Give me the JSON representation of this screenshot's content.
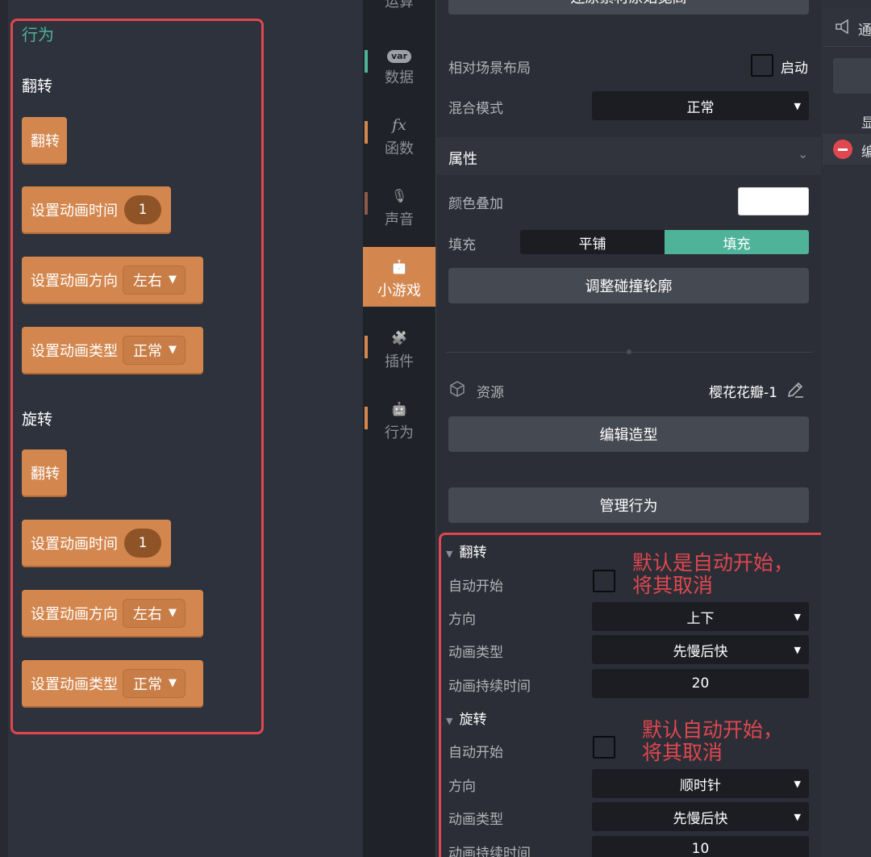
{
  "palette": {
    "category_title": "行为",
    "sections": [
      {
        "title": "翻转",
        "blocks": [
          {
            "label": "翻转"
          },
          {
            "label": "设置动画时间",
            "value": "1"
          },
          {
            "label": "设置动画方向",
            "option": "左右"
          },
          {
            "label": "设置动画类型",
            "option": "正常"
          }
        ]
      },
      {
        "title": "旋转",
        "blocks": [
          {
            "label": "翻转"
          },
          {
            "label": "设置动画时间",
            "value": "1"
          },
          {
            "label": "设置动画方向",
            "option": "左右"
          },
          {
            "label": "设置动画类型",
            "option": "正常"
          }
        ]
      }
    ]
  },
  "categories": [
    {
      "label": "运算",
      "icon": "operators-icon"
    },
    {
      "label": "数据",
      "icon": "var-icon",
      "icon_text": "var"
    },
    {
      "label": "函数",
      "icon": "fx-icon",
      "icon_text": "fx"
    },
    {
      "label": "声音",
      "icon": "microphone-icon",
      "icon_glyph": "🎙"
    },
    {
      "label": "小游戏",
      "icon": "robot-icon",
      "icon_glyph": "🤖",
      "active": true
    },
    {
      "label": "插件",
      "icon": "puzzle-icon",
      "icon_glyph": "🧩"
    },
    {
      "label": "行为",
      "icon": "robot-icon",
      "icon_glyph": "🤖"
    }
  ],
  "properties": {
    "restore_button_partial": "还原素材原始宽高",
    "relative_layout": {
      "label": "相对场景布局",
      "checkbox_label": "启动",
      "checked": false
    },
    "blend_mode": {
      "label": "混合模式",
      "value": "正常"
    },
    "attributes_header": "属性",
    "color_overlay": {
      "label": "颜色叠加",
      "color": "#ffffff"
    },
    "fill": {
      "label": "填充",
      "options": [
        "平铺",
        "填充"
      ],
      "selected": "填充"
    },
    "adjust_collision_button": "调整碰撞轮廓",
    "resource": {
      "label": "资源",
      "name": "樱花花瓣-1"
    },
    "edit_shape_button": "编辑造型",
    "manage_behavior_button": "管理行为",
    "behaviors": [
      {
        "title": "翻转",
        "auto_start_label": "自动开始",
        "auto_start": false,
        "direction_label": "方向",
        "direction": "上下",
        "anim_type_label": "动画类型",
        "anim_type": "先慢后快",
        "duration_label": "动画持续时间",
        "duration": "20",
        "annotation": [
          "默认是自动开始，",
          "将其取消"
        ]
      },
      {
        "title": "旋转",
        "auto_start_label": "自动开始",
        "auto_start": false,
        "direction_label": "方向",
        "direction": "顺时针",
        "anim_type_label": "动画类型",
        "anim_type": "先慢后快",
        "duration_label": "动画持续时间",
        "duration": "10",
        "annotation": [
          "默认自动开始，",
          "将其取消"
        ]
      }
    ]
  },
  "right_panel": {
    "partial_tab": "通",
    "partial_label_1": "显",
    "partial_label_2": "编"
  },
  "colors": {
    "accent_green": "#4fb39a",
    "block_orange": "#d3874e",
    "annotation_red": "#e0474f"
  }
}
